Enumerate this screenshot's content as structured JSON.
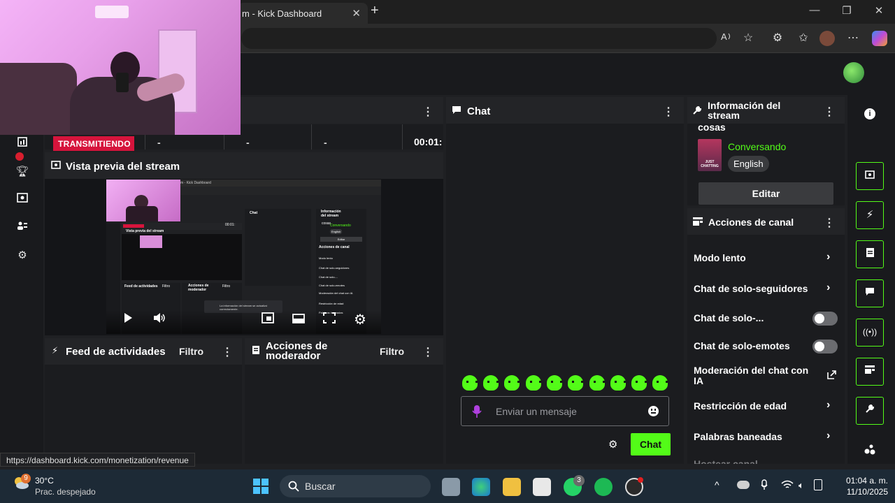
{
  "browser": {
    "tab_title": "m - Kick Dashboard",
    "tab_close": "✕",
    "new_tab": "+",
    "minimize": "—",
    "restore": "❐",
    "close": "✕",
    "status_url": "https://dashboard.kick.com/monetization/revenue"
  },
  "stats": {
    "live_label": "TRANSMITIENDO",
    "stat1": "-",
    "stat2": "-",
    "stat3": "-",
    "timer": "00:01:"
  },
  "preview": {
    "title": "Vista previa del stream",
    "inner_title": "Vista previa del stream",
    "inner_chat": "Chat",
    "inner_info": "Información del stream",
    "inner_feed": "Feed de actividades",
    "inner_mod": "Acciones de moderador",
    "inner_filter": "Filtro",
    "inner_toast": "La información del stream se actualizó correctamente."
  },
  "feed": {
    "title": "Feed de actividades",
    "filter": "Filtro"
  },
  "mod_actions": {
    "title": "Acciones de moderador",
    "filter": "Filtro"
  },
  "chat": {
    "title": "Chat",
    "placeholder": "Enviar un mensaje",
    "send": "Chat"
  },
  "stream_info": {
    "title": "Información del stream",
    "stream_title": "cosas",
    "category": "Conversando",
    "category_art": "JUST CHATTING",
    "language": "English",
    "edit": "Editar"
  },
  "channel_actions": {
    "title": "Acciones de canal",
    "items": [
      {
        "label": "Modo lento",
        "control": "chevron"
      },
      {
        "label": "Chat de solo-seguidores",
        "control": "chevron"
      },
      {
        "label": "Chat de solo-...",
        "control": "toggle",
        "on": false
      },
      {
        "label": "Chat de solo-emotes",
        "control": "toggle",
        "on": false
      },
      {
        "label": "Moderación del chat con IA",
        "control": "external"
      },
      {
        "label": "Restricción de edad",
        "control": "chevron"
      },
      {
        "label": "Palabras baneadas",
        "control": "chevron"
      },
      {
        "label": "Hostear canal",
        "control": "none"
      }
    ]
  },
  "taskbar": {
    "weather_temp": "30°C",
    "weather_desc": "Prac. despejado",
    "weather_badge": "9",
    "search": "Buscar",
    "whatsapp_badge": "3",
    "time": "01:04 a. m.",
    "date": "11/10/2025"
  },
  "colors": {
    "accent": "#53fc18",
    "live": "#d6143c"
  }
}
